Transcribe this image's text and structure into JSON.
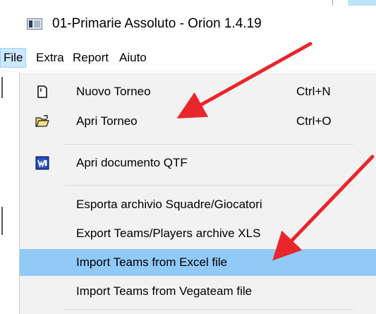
{
  "window": {
    "title": "01-Primarie Assoluto - Orion 1.4.19",
    "app_icon": "app-window-icon"
  },
  "menubar": {
    "items": [
      {
        "label": "File",
        "active": true
      },
      {
        "label": "Extra",
        "active": false
      },
      {
        "label": "Report",
        "active": false
      },
      {
        "label": "Aiuto",
        "active": false
      }
    ]
  },
  "file_menu": {
    "items": [
      {
        "label": "Nuovo Torneo",
        "shortcut": "Ctrl+N",
        "icon": "new-document-icon"
      },
      {
        "label": "Apri Torneo",
        "shortcut": "Ctrl+O",
        "icon": "open-folder-icon"
      },
      {
        "label": "Apri documento QTF",
        "shortcut": "",
        "icon": "word-document-icon"
      },
      {
        "label": "Esporta archivio Squadre/Giocatori",
        "shortcut": ""
      },
      {
        "label": "Export Teams/Players archive XLS",
        "shortcut": ""
      },
      {
        "label": "Import Teams from Excel file",
        "shortcut": "",
        "highlighted": true
      },
      {
        "label": "Import Teams from Vegateam file",
        "shortcut": ""
      }
    ]
  },
  "annotations": {
    "arrow_color": "#e8262b",
    "highlight_color": "#91c9f7"
  }
}
